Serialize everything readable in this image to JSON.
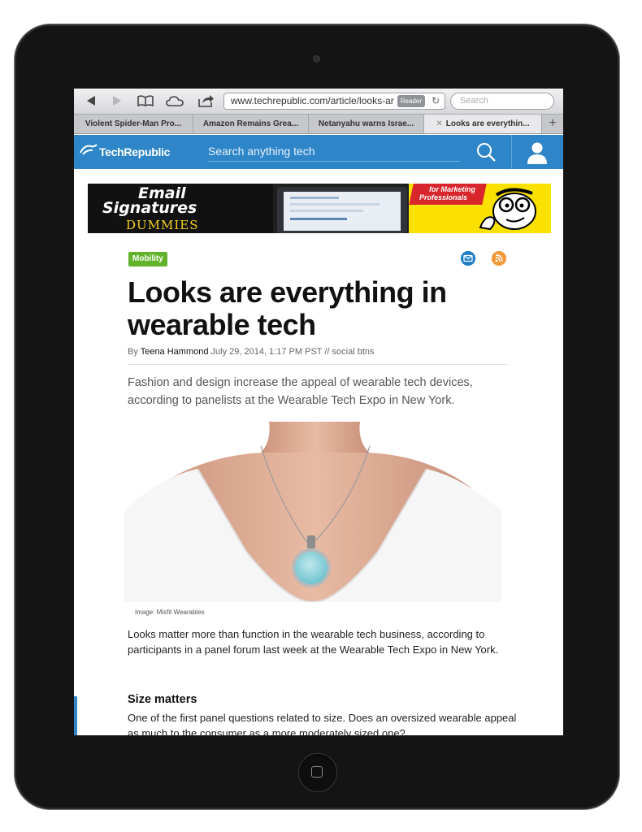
{
  "browser": {
    "url": "www.techrepublic.com/article/looks-ar",
    "reader_label": "Reader",
    "search_placeholder": "Search",
    "tabs": [
      {
        "label": "Violent Spider-Man Pro..."
      },
      {
        "label": "Amazon Remains Grea..."
      },
      {
        "label": "Netanyahu warns Israe..."
      },
      {
        "label": "Looks are everythin..."
      }
    ]
  },
  "site": {
    "logo": "TechRepublic",
    "search_placeholder": "Search anything tech",
    "brand_color": "#2e86c8"
  },
  "ad": {
    "title_line1": "Email",
    "title_line2": "Signatures",
    "title_line3": "DUMMIES",
    "tagline_line1": "for Marketing",
    "tagline_line2": "Professionals"
  },
  "article": {
    "category": "Mobility",
    "category_color": "#62b32b",
    "headline": "Looks are everything in wearable tech",
    "byline_prefix": "By",
    "author": "Teena Hammond",
    "dateline": "July 29, 2014, 1:17 PM PST // social btns",
    "dek": "Fashion and design increase the appeal of wearable tech devices, according to panelists at the Wearable Tech Expo in New York.",
    "image_caption": "Image: Misfit Wearables",
    "paragraph1": "Looks matter more than function in the wearable tech business, according to participants in a panel forum last week at the Wearable Tech Expo in New York.",
    "subhead": "Size matters",
    "paragraph2": "One of the first panel questions related to size. Does an oversized wearable appeal as much to the consumer as a more moderately sized one?"
  },
  "icons": [
    "back-icon",
    "forward-icon",
    "bookmarks-icon",
    "cloud-icon",
    "share-icon",
    "reload-icon",
    "search-icon",
    "user-icon",
    "mail-icon",
    "rss-icon"
  ]
}
